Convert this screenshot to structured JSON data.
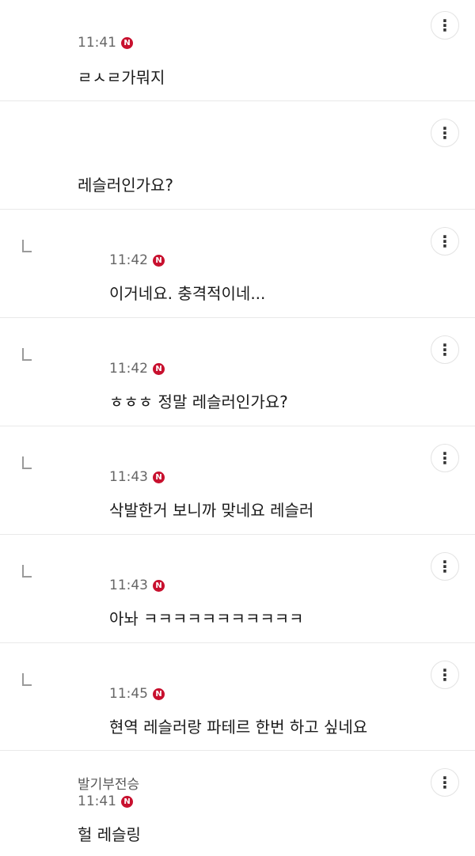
{
  "comments": [
    {
      "time": "11:41",
      "badge": "N",
      "text": "ㄹㅅㄹ가뭐지",
      "reply": false
    },
    {
      "time": "",
      "badge": "",
      "text": "레슬러인가요?",
      "reply": false
    },
    {
      "time": "11:42",
      "badge": "N",
      "text": "이거네요. 충격적이네...",
      "reply": true
    },
    {
      "time": "11:42",
      "badge": "N",
      "text": "ㅎㅎㅎ 정말 레슬러인가요?",
      "reply": true
    },
    {
      "time": "11:43",
      "badge": "N",
      "text": "삭발한거 보니까 맞네요 레슬러",
      "reply": true
    },
    {
      "time": "11:43",
      "badge": "N",
      "text": "아놔 ㅋㅋㅋㅋㅋㅋㅋㅋㅋㅋㅋ",
      "reply": true
    },
    {
      "time": "11:45",
      "badge": "N",
      "text": "현역 레슬러랑 파테르 한번 하고 싶네요",
      "reply": true
    },
    {
      "author": "발기부전승",
      "time": "11:41",
      "badge": "N",
      "text": "헐 레슬링",
      "reply": false
    }
  ],
  "more_label": "⋮"
}
